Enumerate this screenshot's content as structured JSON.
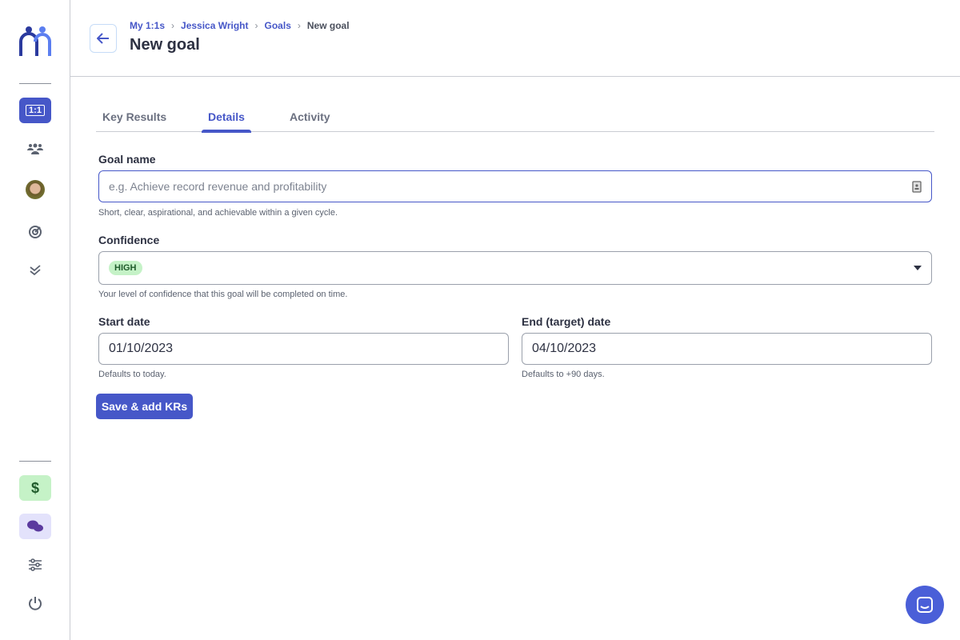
{
  "sidebar": {
    "one_on_one_label": "1:1",
    "colors": {
      "accent": "#4657c8",
      "billing_bg": "#c5f2c7",
      "help_bg": "#e3e2fb"
    },
    "icons": [
      "logo",
      "one-on-one-icon",
      "team-icon",
      "avatar",
      "goals-target-icon",
      "tasks-check-icon",
      "dollar-icon",
      "help-chat-icon",
      "settings-sliders-icon",
      "power-icon"
    ],
    "dollar": "$"
  },
  "header": {
    "breadcrumb": [
      "My 1:1s",
      "Jessica Wright",
      "Goals",
      "New goal"
    ],
    "title": "New goal"
  },
  "tabs": [
    {
      "label": "Key Results"
    },
    {
      "label": "Details",
      "active": true
    },
    {
      "label": "Activity"
    }
  ],
  "form": {
    "goal_name": {
      "label": "Goal name",
      "placeholder": "e.g. Achieve record revenue and profitability",
      "value": "",
      "help": "Short, clear, aspirational, and achievable within a given cycle."
    },
    "confidence": {
      "label": "Confidence",
      "value": "HIGH",
      "help": "Your level of confidence that this goal will be completed on time."
    },
    "start_date": {
      "label": "Start date",
      "value": "01/10/2023",
      "help": "Defaults to today."
    },
    "end_date": {
      "label": "End (target) date",
      "value": "04/10/2023",
      "help": "Defaults to +90 days."
    },
    "submit": "Save & add KRs"
  }
}
